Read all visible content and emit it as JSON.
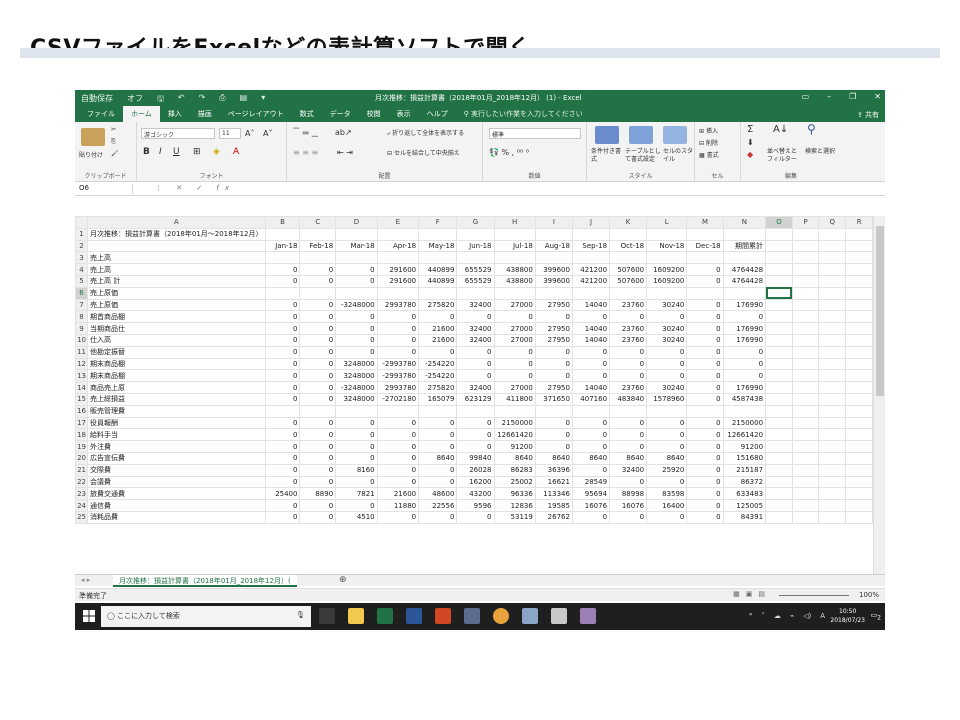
{
  "slide": {
    "title": "CSVファイルをExcelなどの表計算ソフトで開く"
  },
  "window": {
    "title": "月次推移：損益計算書（2018年01月_2018年12月） (1) - Excel",
    "autosave": "自動保存",
    "autosave_state": "オフ"
  },
  "ribbon_tabs": [
    "ファイル",
    "ホーム",
    "挿入",
    "描画",
    "ページレイアウト",
    "数式",
    "データ",
    "校閲",
    "表示",
    "ヘルプ"
  ],
  "active_tab": "ホーム",
  "tell_me": "実行したい作業を入力してください",
  "share": "共有",
  "ribbon": {
    "clipboard": {
      "paste": "貼り付け",
      "label": "クリップボード"
    },
    "font": {
      "name": "游ゴシック",
      "size": "11",
      "label": "フォント"
    },
    "alignment": {
      "wrap": "折り返して全体を表示する",
      "merge": "セルを結合して中央揃え",
      "label": "配置"
    },
    "number": {
      "format": "標準",
      "label": "数値"
    },
    "styles": {
      "conditional": "条件付き書式",
      "table": "テーブルとして書式設定",
      "cell": "セルのスタイル",
      "label": "スタイル"
    },
    "cells": {
      "insert": "挿入",
      "delete": "削除",
      "format": "書式",
      "label": "セル"
    },
    "editing": {
      "sort": "並べ替えとフィルター",
      "find": "検索と選択",
      "label": "編集"
    }
  },
  "formula_bar": {
    "name_box": "O6",
    "fx": "fx",
    "value": ""
  },
  "columns": [
    "A",
    "B",
    "C",
    "D",
    "E",
    "F",
    "G",
    "H",
    "I",
    "J",
    "K",
    "L",
    "M",
    "N",
    "O",
    "P",
    "Q",
    "R"
  ],
  "selected_column": "O",
  "selected_row": "6",
  "rows": [
    {
      "n": "1",
      "cells": [
        "月次推移：損益計算書（2018年01月～2018年12月）",
        "",
        "",
        "",
        "",
        "",
        "",
        "",
        "",
        "",
        "",
        "",
        "",
        ""
      ]
    },
    {
      "n": "2",
      "cells": [
        "",
        "Jan-18",
        "Feb-18",
        "Mar-18",
        "Apr-18",
        "May-18",
        "Jun-18",
        "Jul-18",
        "Aug-18",
        "Sep-18",
        "Oct-18",
        "Nov-18",
        "Dec-18",
        "期間累計"
      ]
    },
    {
      "n": "3",
      "cells": [
        "売上高",
        "",
        "",
        "",
        "",
        "",
        "",
        "",
        "",
        "",
        "",
        "",
        "",
        ""
      ]
    },
    {
      "n": "4",
      "cells": [
        "売上高",
        "0",
        "0",
        "0",
        "291600",
        "440899",
        "655529",
        "438800",
        "399600",
        "421200",
        "507600",
        "1609200",
        "0",
        "4764428"
      ]
    },
    {
      "n": "5",
      "cells": [
        "売上高 計",
        "0",
        "0",
        "0",
        "291600",
        "440899",
        "655529",
        "438800",
        "399600",
        "421200",
        "507600",
        "1609200",
        "0",
        "4764428"
      ]
    },
    {
      "n": "6",
      "cells": [
        "売上原価",
        "",
        "",
        "",
        "",
        "",
        "",
        "",
        "",
        "",
        "",
        "",
        "",
        ""
      ]
    },
    {
      "n": "7",
      "cells": [
        "売上原価",
        "0",
        "0",
        "-3248000",
        "2993780",
        "275820",
        "32400",
        "27000",
        "27950",
        "14040",
        "23760",
        "30240",
        "0",
        "176990"
      ]
    },
    {
      "n": "8",
      "cells": [
        "期首商品棚",
        "0",
        "0",
        "0",
        "0",
        "0",
        "0",
        "0",
        "0",
        "0",
        "0",
        "0",
        "0",
        "0"
      ]
    },
    {
      "n": "9",
      "cells": [
        "当期商品仕",
        "0",
        "0",
        "0",
        "0",
        "21600",
        "32400",
        "27000",
        "27950",
        "14040",
        "23760",
        "30240",
        "0",
        "176990"
      ]
    },
    {
      "n": "10",
      "cells": [
        "仕入高",
        "0",
        "0",
        "0",
        "0",
        "21600",
        "32400",
        "27000",
        "27950",
        "14040",
        "23760",
        "30240",
        "0",
        "176990"
      ]
    },
    {
      "n": "11",
      "cells": [
        "他勘定振替",
        "0",
        "0",
        "0",
        "0",
        "0",
        "0",
        "0",
        "0",
        "0",
        "0",
        "0",
        "0",
        "0"
      ]
    },
    {
      "n": "12",
      "cells": [
        "期末商品棚",
        "0",
        "0",
        "3248000",
        "-2993780",
        "-254220",
        "0",
        "0",
        "0",
        "0",
        "0",
        "0",
        "0",
        "0"
      ]
    },
    {
      "n": "13",
      "cells": [
        "期末商品棚",
        "0",
        "0",
        "3248000",
        "-2993780",
        "-254220",
        "0",
        "0",
        "0",
        "0",
        "0",
        "0",
        "0",
        "0"
      ]
    },
    {
      "n": "14",
      "cells": [
        "商品売上原",
        "0",
        "0",
        "-3248000",
        "2993780",
        "275820",
        "32400",
        "27000",
        "27950",
        "14040",
        "23760",
        "30240",
        "0",
        "176990"
      ]
    },
    {
      "n": "15",
      "cells": [
        "売上総損益",
        "0",
        "0",
        "3248000",
        "-2702180",
        "165079",
        "623129",
        "411800",
        "371650",
        "407160",
        "483840",
        "1578960",
        "0",
        "4587438"
      ]
    },
    {
      "n": "16",
      "cells": [
        "販売管理費",
        "",
        "",
        "",
        "",
        "",
        "",
        "",
        "",
        "",
        "",
        "",
        "",
        ""
      ]
    },
    {
      "n": "17",
      "cells": [
        "役員報酬",
        "0",
        "0",
        "0",
        "0",
        "0",
        "0",
        "2150000",
        "0",
        "0",
        "0",
        "0",
        "0",
        "2150000"
      ]
    },
    {
      "n": "18",
      "cells": [
        "給料手当",
        "0",
        "0",
        "0",
        "0",
        "0",
        "0",
        "12661420",
        "0",
        "0",
        "0",
        "0",
        "0",
        "12661420"
      ]
    },
    {
      "n": "19",
      "cells": [
        "外注費",
        "0",
        "0",
        "0",
        "0",
        "0",
        "0",
        "91200",
        "0",
        "0",
        "0",
        "0",
        "0",
        "91200"
      ]
    },
    {
      "n": "20",
      "cells": [
        "広告宣伝費",
        "0",
        "0",
        "0",
        "0",
        "8640",
        "99840",
        "8640",
        "8640",
        "8640",
        "8640",
        "8640",
        "0",
        "151680"
      ]
    },
    {
      "n": "21",
      "cells": [
        "交際費",
        "0",
        "0",
        "8160",
        "0",
        "0",
        "26028",
        "86283",
        "36396",
        "0",
        "32400",
        "25920",
        "0",
        "215187"
      ]
    },
    {
      "n": "22",
      "cells": [
        "会議費",
        "0",
        "0",
        "0",
        "0",
        "0",
        "16200",
        "25002",
        "16621",
        "28549",
        "0",
        "0",
        "0",
        "86372"
      ]
    },
    {
      "n": "23",
      "cells": [
        "旅費交通費",
        "25400",
        "8890",
        "7821",
        "21600",
        "48600",
        "43200",
        "96336",
        "113346",
        "95694",
        "88998",
        "83598",
        "0",
        "633483"
      ]
    },
    {
      "n": "24",
      "cells": [
        "通信費",
        "0",
        "0",
        "0",
        "11880",
        "22556",
        "9596",
        "12836",
        "19585",
        "16076",
        "16076",
        "16400",
        "0",
        "125005"
      ]
    },
    {
      "n": "25",
      "cells": [
        "消耗品費",
        "0",
        "0",
        "4510",
        "0",
        "0",
        "0",
        "53119",
        "26762",
        "0",
        "0",
        "0",
        "0",
        "84391"
      ]
    }
  ],
  "sheet_tab": "月次推移：損益計算書（2018年01月_2018年12月）(",
  "add_sheet": "⊕",
  "status": {
    "ready": "準備完了",
    "zoom": "100%"
  },
  "taskbar": {
    "search_placeholder": "ここに入力して検索",
    "time": "10:50",
    "date": "2018/07/23",
    "ime": "A",
    "notifications": "2"
  }
}
